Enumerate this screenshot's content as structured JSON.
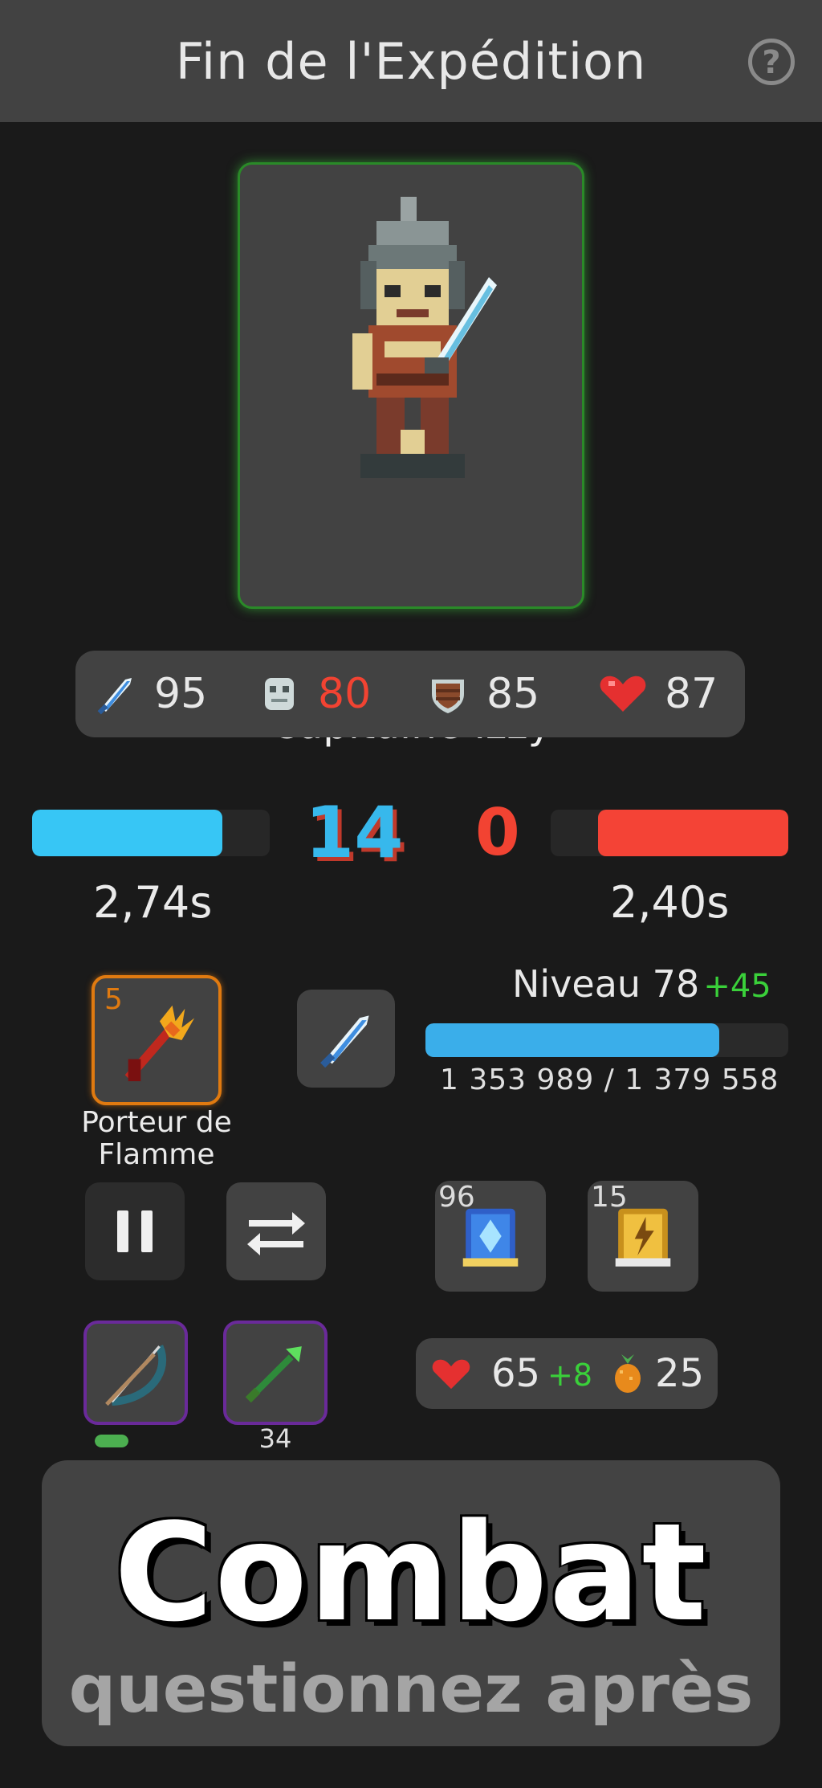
{
  "header": {
    "title": "Fin de l'Expédition",
    "help_icon": "question-circle-icon",
    "help_glyph": "?"
  },
  "hero": {
    "name": "Capitaine Izzy",
    "portrait": "knight-with-sword"
  },
  "stats": {
    "attack": {
      "icon": "sword-icon",
      "value": "95"
    },
    "vision": {
      "icon": "mask-icon",
      "value": "80",
      "color": "#f24332"
    },
    "defense": {
      "icon": "shield-icon",
      "value": "85"
    },
    "health": {
      "icon": "heart-icon",
      "value": "87"
    }
  },
  "battle": {
    "player_score": "14",
    "enemy_score": "0",
    "player_timer": "2,74s",
    "enemy_timer": "2,40s",
    "player_bar_fraction": 0.8,
    "enemy_bar_fraction": 0.8,
    "player_color": "#37c6f5",
    "enemy_color": "#f44336"
  },
  "gear": {
    "weapon": {
      "label": "Porteur de Flamme",
      "level": "5",
      "icon": "flame-trident-icon",
      "border": "#e07a10"
    },
    "equipped_icon": "sword-icon"
  },
  "level": {
    "label": "Niveau 78",
    "bonus": "+45",
    "xp_text": "1 353 989 / 1 379 558",
    "xp_fraction": 0.81
  },
  "controls": {
    "pause_icon": "pause-icon",
    "swap_icon": "swap-arrows-icon"
  },
  "books": [
    {
      "count": "96",
      "icon": "blue-spellbook-icon"
    },
    {
      "count": "15",
      "icon": "gold-spellbook-icon"
    }
  ],
  "consumables": [
    {
      "icon": "bow-icon",
      "bar_fraction": 1.0
    },
    {
      "icon": "green-arrow-icon",
      "count": "34"
    }
  ],
  "resources": {
    "hearts": "65",
    "hearts_bonus": "+8",
    "fruit": "25"
  },
  "combat": {
    "title": "Combat",
    "subtitle": "questionnez après"
  }
}
